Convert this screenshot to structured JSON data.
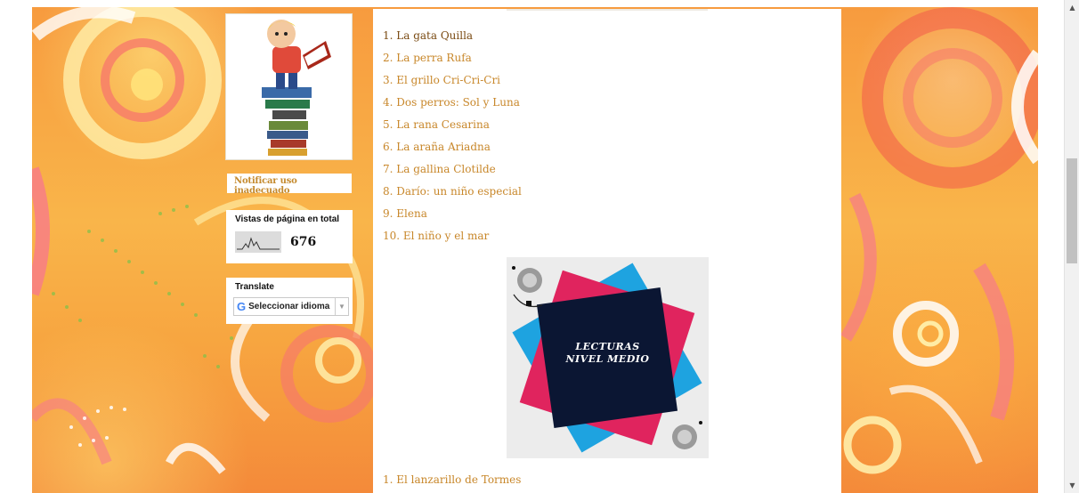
{
  "sidebar": {
    "report_link": "Notificar uso inadecuado",
    "views": {
      "title": "Vistas de página en total",
      "count": "676"
    },
    "translate": {
      "title": "Translate",
      "select_label": "Seleccionar idioma",
      "g_logo": "G"
    }
  },
  "main": {
    "stories": [
      "1. La gata Quilla",
      "2. La perra Rufa",
      "3. El grillo Cri-Cri-Cri",
      "4. Dos perros: Sol y Luna",
      "5. La rana Cesarina",
      "6. La araña Ariadna",
      "7. La gallina Clotilde",
      "8. Darío: un niño especial",
      "9. Elena",
      "10. El niño y el mar"
    ],
    "cover": {
      "line1": "LECTURAS",
      "line2": "NIVEL MEDIO"
    },
    "next_story": "1. El lanzarillo de Tormes"
  },
  "icons": {
    "scroll_up": "scroll-up-arrow",
    "scroll_down": "scroll-down-arrow",
    "dropdown": "chevron-down-icon"
  },
  "colors": {
    "link": "#c8872a",
    "link_active": "#7a4a12",
    "background": "#f6a24a"
  }
}
